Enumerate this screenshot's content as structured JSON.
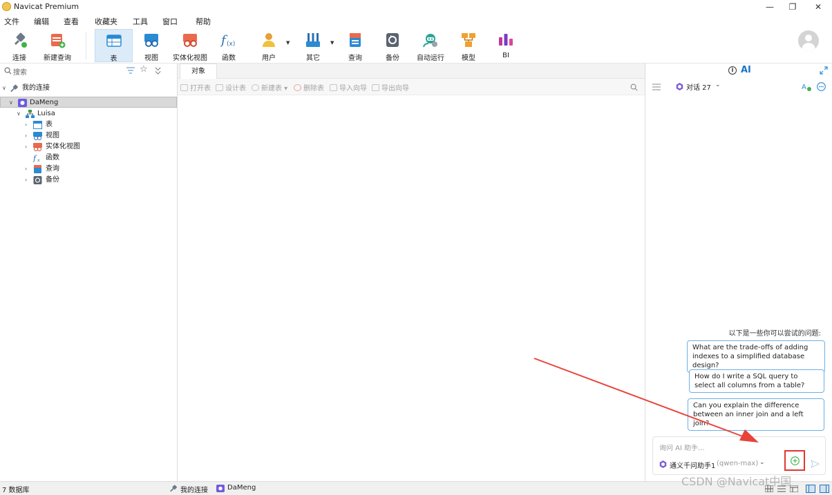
{
  "window": {
    "title": "Navicat Premium",
    "controls": {
      "minimize": "—",
      "maximize": "❐",
      "close": "✕"
    }
  },
  "menu": [
    "文件",
    "编辑",
    "查看",
    "收藏夹",
    "工具",
    "窗口",
    "帮助"
  ],
  "toolbar": {
    "items": [
      {
        "label": "连接",
        "icon": "plug-icon"
      },
      {
        "label": "新建查询",
        "icon": "new-query-icon"
      },
      {
        "label": "表",
        "icon": "table-icon"
      },
      {
        "label": "视图",
        "icon": "view-icon"
      },
      {
        "label": "实体化视图",
        "icon": "materialized-view-icon"
      },
      {
        "label": "函数",
        "icon": "function-icon"
      },
      {
        "label": "用户",
        "icon": "user-icon"
      },
      {
        "label": "其它",
        "icon": "other-icon"
      },
      {
        "label": "查询",
        "icon": "query-icon"
      },
      {
        "label": "备份",
        "icon": "backup-icon"
      },
      {
        "label": "自动运行",
        "icon": "automation-icon"
      },
      {
        "label": "模型",
        "icon": "model-icon"
      },
      {
        "label": "BI",
        "icon": "bi-icon"
      }
    ]
  },
  "navigator": {
    "search_placeholder": "搜索",
    "root": "我的连接",
    "connection": "DaMeng",
    "schema": "Luisa",
    "children": [
      "表",
      "视图",
      "实体化视图",
      "函数",
      "查询",
      "备份"
    ]
  },
  "center": {
    "tab": "对象",
    "actions": [
      "打开表",
      "设计表",
      "新建表",
      "删除表",
      "导入向导",
      "导出向导"
    ]
  },
  "ai": {
    "title": "AI",
    "chat_name": "对话 27",
    "hint": "以下是一些你可以尝试的问题:",
    "suggestions": [
      "What are the trade-offs of adding indexes to a simplified database design?",
      "How do I write a SQL query to select all columns from a table?",
      "Can you explain the difference between an inner join and a left join?"
    ],
    "input_placeholder": "询问 AI 助手...",
    "model_name": "通义千问助手1",
    "model_id": "(qwen-max)"
  },
  "status": {
    "db_count": "7 数据库",
    "connection": "我的连接",
    "database": "DaMeng"
  },
  "watermark": "CSDN @Navicat中国",
  "colors": {
    "accent": "#1a73c7",
    "annotation": "#e8433a",
    "selected": "#d9d9d9"
  }
}
